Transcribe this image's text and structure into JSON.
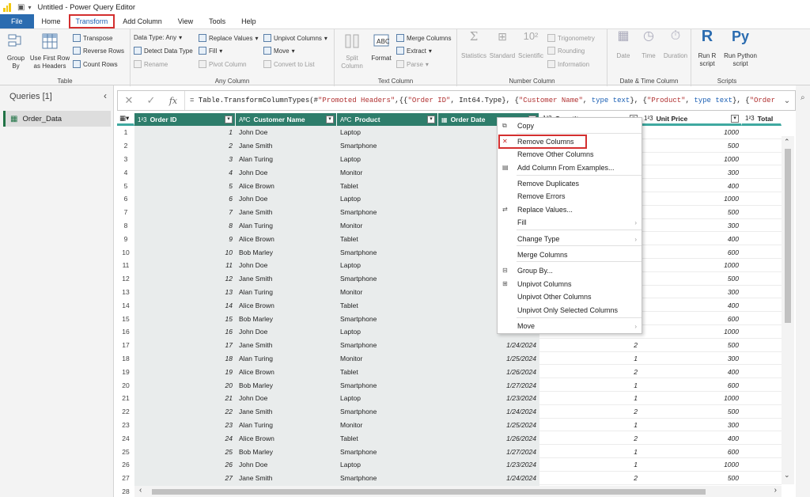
{
  "window": {
    "title": "Untitled - Power Query Editor"
  },
  "tabs": [
    "File",
    "Home",
    "Transform",
    "Add Column",
    "View",
    "Tools",
    "Help"
  ],
  "active_tab": "Transform",
  "ribbon": {
    "table": {
      "label": "Table",
      "group_by": "Group\nBy",
      "use_first_row": "Use First Row\nas Headers",
      "transpose": "Transpose",
      "reverse_rows": "Reverse Rows",
      "count_rows": "Count Rows"
    },
    "any_column": {
      "label": "Any Column",
      "data_type": "Data Type: Any",
      "detect_data_type": "Detect Data Type",
      "rename": "Rename",
      "replace_values": "Replace Values",
      "fill": "Fill",
      "pivot_column": "Pivot Column",
      "unpivot_columns": "Unpivot Columns",
      "move": "Move",
      "convert_to_list": "Convert to List"
    },
    "text_column": {
      "label": "Text Column",
      "split_column": "Split\nColumn",
      "format": "Format",
      "merge_columns": "Merge Columns",
      "extract": "Extract",
      "parse": "Parse"
    },
    "number_column": {
      "label": "Number Column",
      "statistics": "Statistics",
      "standard": "Standard",
      "scientific": "Scientific",
      "trigonometry": "Trigonometry",
      "rounding": "Rounding",
      "information": "Information"
    },
    "datetime": {
      "label": "Date & Time Column",
      "date": "Date",
      "time": "Time",
      "duration": "Duration"
    },
    "scripts": {
      "label": "Scripts",
      "run_r": "Run R\nscript",
      "run_python": "Run Python\nscript"
    }
  },
  "queries": {
    "header": "Queries [1]",
    "items": [
      "Order_Data"
    ]
  },
  "formula": {
    "prefix": "= Table.TransformColumnTypes(#",
    "s1": "\"Promoted Headers\"",
    "p1": ",{{",
    "s2": "\"Order ID\"",
    "p2": ", Int64.Type}, {",
    "s3": "\"Customer Name\"",
    "p3": ", ",
    "k1": "type text",
    "p4": "}, {",
    "s4": "\"Product\"",
    "p5": ", ",
    "k2": "type text",
    "p6": "}, {",
    "s5": "\"Order"
  },
  "columns": [
    {
      "type": "1²3",
      "name": "Order ID"
    },
    {
      "type": "AᴮC",
      "name": "Customer Name"
    },
    {
      "type": "AᴮC",
      "name": "Product"
    },
    {
      "type": "▦",
      "name": "Order Date"
    },
    {
      "type": "1²3",
      "name": "Quantity"
    },
    {
      "type": "1²3",
      "name": "Unit Price"
    },
    {
      "type": "1²3",
      "name": "Total"
    }
  ],
  "rows": [
    {
      "n": "1",
      "id": "1",
      "name": "John Doe",
      "product": "Laptop",
      "date": "",
      "qty": "",
      "price": "1000"
    },
    {
      "n": "2",
      "id": "2",
      "name": "Jane Smith",
      "product": "Smartphone",
      "date": "",
      "qty": "",
      "price": "500"
    },
    {
      "n": "3",
      "id": "3",
      "name": "Alan Turing",
      "product": "Laptop",
      "date": "",
      "qty": "",
      "price": "1000"
    },
    {
      "n": "4",
      "id": "4",
      "name": "John Doe",
      "product": "Monitor",
      "date": "",
      "qty": "",
      "price": "300"
    },
    {
      "n": "5",
      "id": "5",
      "name": "Alice Brown",
      "product": "Tablet",
      "date": "",
      "qty": "",
      "price": "400"
    },
    {
      "n": "6",
      "id": "6",
      "name": "John Doe",
      "product": "Laptop",
      "date": "",
      "qty": "",
      "price": "1000"
    },
    {
      "n": "7",
      "id": "7",
      "name": "Jane Smith",
      "product": "Smartphone",
      "date": "",
      "qty": "",
      "price": "500"
    },
    {
      "n": "8",
      "id": "8",
      "name": "Alan Turing",
      "product": "Monitor",
      "date": "",
      "qty": "",
      "price": "300"
    },
    {
      "n": "9",
      "id": "9",
      "name": "Alice Brown",
      "product": "Tablet",
      "date": "",
      "qty": "",
      "price": "400"
    },
    {
      "n": "10",
      "id": "10",
      "name": "Bob Marley",
      "product": "Smartphone",
      "date": "",
      "qty": "",
      "price": "600"
    },
    {
      "n": "11",
      "id": "11",
      "name": "John Doe",
      "product": "Laptop",
      "date": "",
      "qty": "",
      "price": "1000"
    },
    {
      "n": "12",
      "id": "12",
      "name": "Jane Smith",
      "product": "Smartphone",
      "date": "",
      "qty": "",
      "price": "500"
    },
    {
      "n": "13",
      "id": "13",
      "name": "Alan Turing",
      "product": "Monitor",
      "date": "",
      "qty": "",
      "price": "300"
    },
    {
      "n": "14",
      "id": "14",
      "name": "Alice Brown",
      "product": "Tablet",
      "date": "",
      "qty": "",
      "price": "400"
    },
    {
      "n": "15",
      "id": "15",
      "name": "Bob Marley",
      "product": "Smartphone",
      "date": "",
      "qty": "",
      "price": "600"
    },
    {
      "n": "16",
      "id": "16",
      "name": "John Doe",
      "product": "Laptop",
      "date": "1/23/2024",
      "qty": "1",
      "price": "1000"
    },
    {
      "n": "17",
      "id": "17",
      "name": "Jane Smith",
      "product": "Smartphone",
      "date": "1/24/2024",
      "qty": "2",
      "price": "500"
    },
    {
      "n": "18",
      "id": "18",
      "name": "Alan Turing",
      "product": "Monitor",
      "date": "1/25/2024",
      "qty": "1",
      "price": "300"
    },
    {
      "n": "19",
      "id": "19",
      "name": "Alice Brown",
      "product": "Tablet",
      "date": "1/26/2024",
      "qty": "2",
      "price": "400"
    },
    {
      "n": "20",
      "id": "20",
      "name": "Bob Marley",
      "product": "Smartphone",
      "date": "1/27/2024",
      "qty": "1",
      "price": "600"
    },
    {
      "n": "21",
      "id": "21",
      "name": "John Doe",
      "product": "Laptop",
      "date": "1/23/2024",
      "qty": "1",
      "price": "1000"
    },
    {
      "n": "22",
      "id": "22",
      "name": "Jane Smith",
      "product": "Smartphone",
      "date": "1/24/2024",
      "qty": "2",
      "price": "500"
    },
    {
      "n": "23",
      "id": "23",
      "name": "Alan Turing",
      "product": "Monitor",
      "date": "1/25/2024",
      "qty": "1",
      "price": "300"
    },
    {
      "n": "24",
      "id": "24",
      "name": "Alice Brown",
      "product": "Tablet",
      "date": "1/26/2024",
      "qty": "2",
      "price": "400"
    },
    {
      "n": "25",
      "id": "25",
      "name": "Bob Marley",
      "product": "Smartphone",
      "date": "1/27/2024",
      "qty": "1",
      "price": "600"
    },
    {
      "n": "26",
      "id": "26",
      "name": "John Doe",
      "product": "Laptop",
      "date": "1/23/2024",
      "qty": "1",
      "price": "1000"
    },
    {
      "n": "27",
      "id": "27",
      "name": "Jane Smith",
      "product": "Smartphone",
      "date": "1/24/2024",
      "qty": "2",
      "price": "500"
    },
    {
      "n": "28",
      "id": "",
      "name": "",
      "product": "",
      "date": "",
      "qty": "",
      "price": ""
    }
  ],
  "context_menu": [
    {
      "label": "Copy",
      "icon": "copy-icon"
    },
    {
      "label": "Remove Columns",
      "icon": "remove-columns-icon",
      "highlight": true
    },
    {
      "label": "Remove Other Columns",
      "icon": ""
    },
    {
      "label": "Add Column From Examples...",
      "icon": "examples-icon"
    },
    {
      "label": "Remove Duplicates",
      "icon": ""
    },
    {
      "label": "Remove Errors",
      "icon": ""
    },
    {
      "label": "Replace Values...",
      "icon": "replace-icon"
    },
    {
      "label": "Fill",
      "icon": "",
      "submenu": true
    },
    {
      "label": "Change Type",
      "icon": "",
      "submenu": true
    },
    {
      "label": "Merge Columns",
      "icon": ""
    },
    {
      "label": "Group By...",
      "icon": "group-icon"
    },
    {
      "label": "Unpivot Columns",
      "icon": "unpivot-icon"
    },
    {
      "label": "Unpivot Other Columns",
      "icon": ""
    },
    {
      "label": "Unpivot Only Selected Columns",
      "icon": ""
    },
    {
      "label": "Move",
      "icon": "",
      "submenu": true
    }
  ],
  "colors": {
    "selected_header": "#2e7d6b",
    "accent_teal": "#3fa9a0",
    "highlight": "#d32f2f",
    "file_tab": "#2b6cb0"
  }
}
